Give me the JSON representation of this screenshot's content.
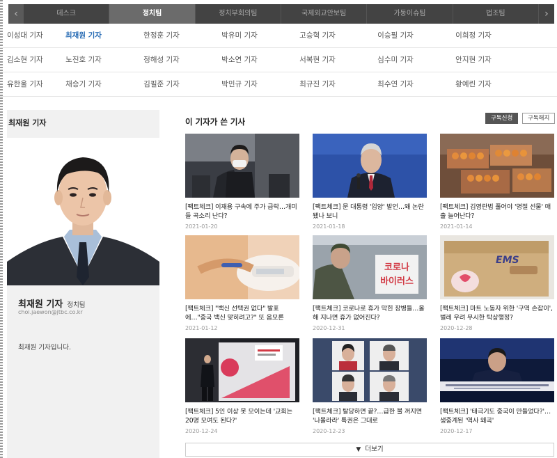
{
  "tabs": [
    "데스크",
    "정치팀",
    "정치부회의팀",
    "국제외교안보팀",
    "가동이슈팀",
    "법조팀"
  ],
  "tab_arrows": {
    "left": "‹",
    "right": "›"
  },
  "reporters": [
    [
      "이성대 기자",
      "최재원 기자",
      "한정훈 기자",
      "박유미 기자",
      "고승혁 기자",
      "이승필 기자",
      "이희정 기자"
    ],
    [
      "김소현 기자",
      "노진호 기자",
      "정해성 기자",
      "박소연 기자",
      "서복현 기자",
      "심수미 기자",
      "안지현 기자"
    ],
    [
      "유한울 기자",
      "채승기 기자",
      "김필준 기자",
      "박민규 기자",
      "최규진 기자",
      "최수연 기자",
      "황예린 기자"
    ]
  ],
  "profile": {
    "header": "최재원 기자",
    "name": "최재원 기자",
    "team": "정치팀",
    "email": "choi.jaewon@jtbc.co.kr",
    "intro": "최재원 기자입니다."
  },
  "articles_section": {
    "title": "이 기자가 쓴 기사",
    "subscribe": "구독신청",
    "unsubscribe": "구독해지",
    "more": "더보기"
  },
  "articles": [
    {
      "title": "[팩트체크] 이재용 구속에 주가 급락…개미들 곡소리 난다?",
      "date": "2021-01-20"
    },
    {
      "title": "[팩트체크] 문 대통령 '입양' 발언…왜 논란 됐나 보니",
      "date": "2021-01-18"
    },
    {
      "title": "[팩트체크] 김영란법 풀어야 '명절 선물' 매출 늘어난다?",
      "date": "2021-01-14"
    },
    {
      "title": "[팩트체크] \"백신 선택권 없다\" 발표에…\"중국 백신 맞히려고?\" 또 음모론",
      "date": "2021-01-12"
    },
    {
      "title": "[팩트체크] 코로나로 휴가 막힌 장병들…올해 지나면 휴가 없어진다?",
      "date": "2020-12-31"
    },
    {
      "title": "[팩트체크] 마트 노동자 위한 '구역 손잡이', 벌레 우려 무시한 탁상행정?",
      "date": "2020-12-28"
    },
    {
      "title": "[팩트체크] 5인 이상 못 모이는데 '교회는 20명 모여도 된다?'",
      "date": "2020-12-24"
    },
    {
      "title": "[팩트체크] 탈당하면 끝?…급한 불 꺼지면 '나몰라라' 특권은 그대로",
      "date": "2020-12-23"
    },
    {
      "title": "[팩트체크] '태극기도 중국이 만들었다?'…생중계된 '역사 왜곡'",
      "date": "2020-12-17"
    }
  ],
  "thumb_texts": {
    "corona_sign": "코로나\n바이러스",
    "box_brand": "EMS"
  }
}
